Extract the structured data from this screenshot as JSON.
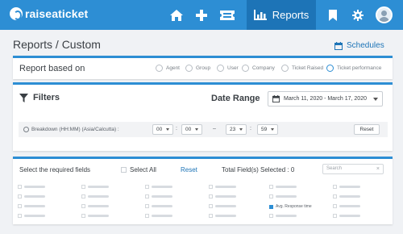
{
  "app": {
    "name": "raiseaticket"
  },
  "nav": {
    "active_label": "Reports",
    "icons": [
      "home-icon",
      "plus-icon",
      "ticket-icon",
      "bar-chart-icon",
      "bookmark-icon",
      "gear-icon",
      "avatar"
    ]
  },
  "page": {
    "title": "Reports / Custom",
    "schedules_label": "Schedules"
  },
  "report_based_on": {
    "label": "Report based on",
    "options": [
      "Agent",
      "Group",
      "User",
      "Company",
      "Ticket Raised",
      "Ticket performance"
    ],
    "selected": "Ticket performance"
  },
  "filters": {
    "label": "Filters",
    "date_range_label": "Date Range",
    "date_range_value": "March 11, 2020 - March 17, 2020",
    "breakdown_label": "Breakdown (HH:MM) (Asia/Calcutta) :",
    "from_hour": "00",
    "from_minute": "00",
    "to_hour": "23",
    "to_minute": "59",
    "separator": "–",
    "reset_label": "Reset"
  },
  "fields": {
    "label": "Select the required fields",
    "select_all_label": "Select All",
    "reset_label": "Reset",
    "total_selected": "Total Field(s) Selected : 0",
    "search_placeholder": "Search",
    "checked_field_label": "Avg. Response time"
  },
  "colors": {
    "primary": "#2d8ed4",
    "primary_dark": "#1d74b7",
    "background": "#f0f2f5"
  }
}
